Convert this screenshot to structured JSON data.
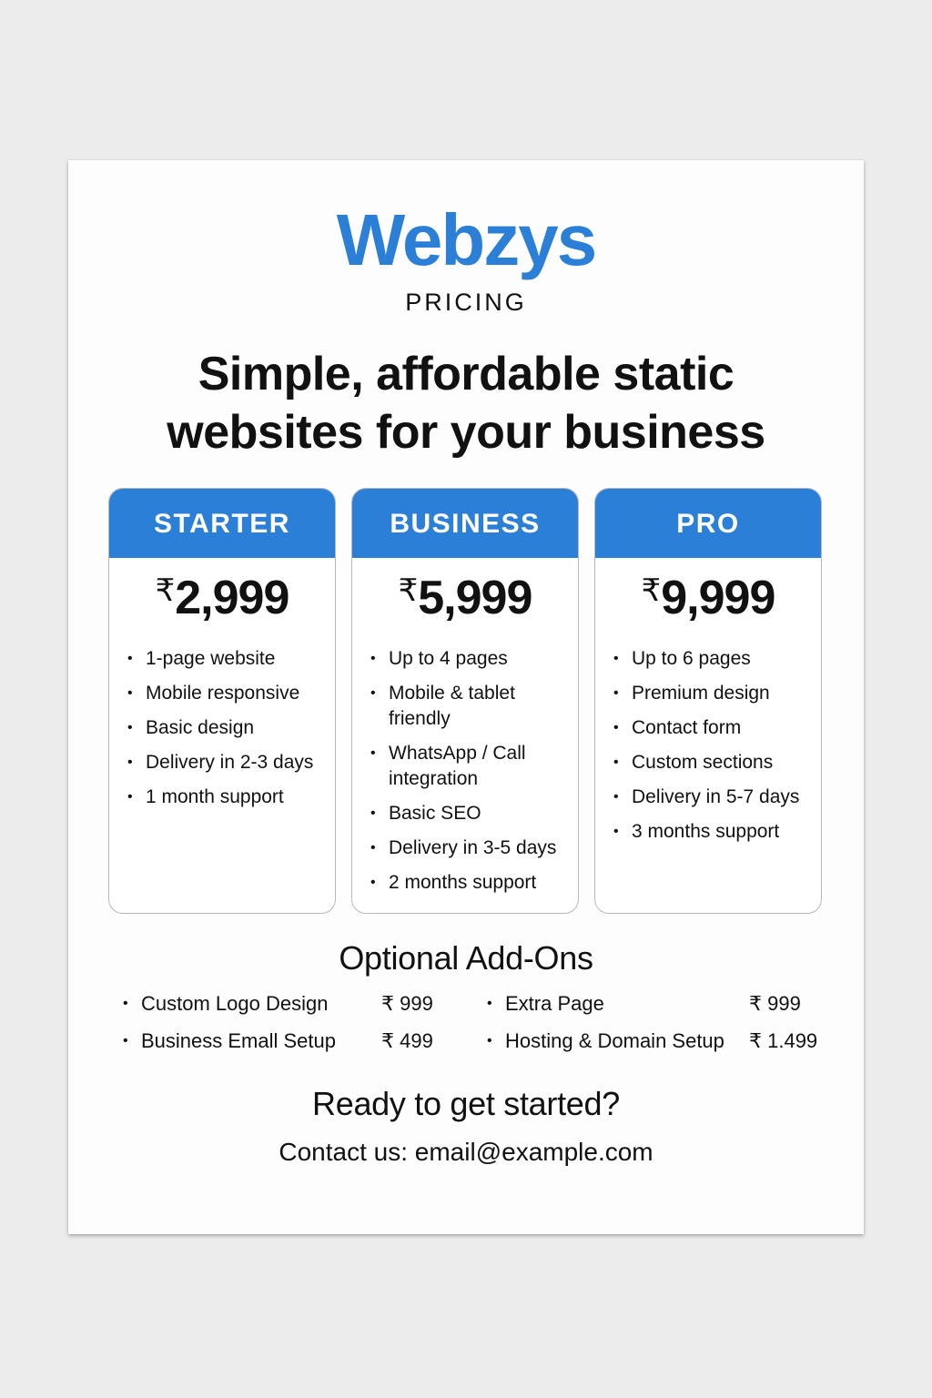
{
  "brand": {
    "name": "Webzys",
    "subtitle": "PRICING"
  },
  "headline": {
    "line1": "Simple, affordable static",
    "line2": "websites for your business"
  },
  "colors": {
    "accent": "#2b7fd6",
    "text": "#111111",
    "card_border": "#b9b9b9"
  },
  "plans": [
    {
      "name": "STARTER",
      "currency": "₹",
      "amount": "2,999",
      "features": [
        "1-page website",
        "Mobile responsive",
        "Basic design",
        "Delivery in 2-3 days",
        "1 month support"
      ]
    },
    {
      "name": "BUSINESS",
      "currency": "₹",
      "amount": "5,999",
      "features": [
        "Up to 4 pages",
        "Mobile & tablet friendly",
        "WhatsApp / Call integration",
        "Basic SEO",
        "Delivery in 3-5 days",
        "2 months support"
      ]
    },
    {
      "name": "PRO",
      "currency": "₹",
      "amount": "9,999",
      "features": [
        "Up to 6 pages",
        "Premium design",
        "Contact form",
        "Custom sections",
        "Delivery in 5-7 days",
        "3 months support"
      ]
    }
  ],
  "addons": {
    "title": "Optional Add-Ons",
    "items": [
      {
        "name": "Custom Logo Design",
        "price": "₹ 999"
      },
      {
        "name": "Business Emall Setup",
        "price": "₹ 499"
      },
      {
        "name": "Extra Page",
        "price": "₹ 999"
      },
      {
        "name": "Hosting & Domain Setup",
        "price": "₹ 1.499"
      }
    ]
  },
  "cta": {
    "title": "Ready to get started?",
    "contact": "Contact us: email@example.com"
  }
}
